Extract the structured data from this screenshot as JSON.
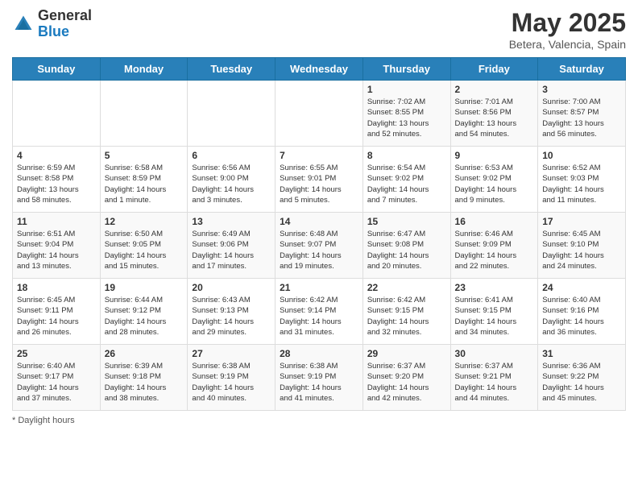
{
  "header": {
    "logo_general": "General",
    "logo_blue": "Blue",
    "month": "May 2025",
    "location": "Betera, Valencia, Spain"
  },
  "days_of_week": [
    "Sunday",
    "Monday",
    "Tuesday",
    "Wednesday",
    "Thursday",
    "Friday",
    "Saturday"
  ],
  "weeks": [
    [
      {
        "day": "",
        "info": ""
      },
      {
        "day": "",
        "info": ""
      },
      {
        "day": "",
        "info": ""
      },
      {
        "day": "",
        "info": ""
      },
      {
        "day": "1",
        "info": "Sunrise: 7:02 AM\nSunset: 8:55 PM\nDaylight: 13 hours\nand 52 minutes."
      },
      {
        "day": "2",
        "info": "Sunrise: 7:01 AM\nSunset: 8:56 PM\nDaylight: 13 hours\nand 54 minutes."
      },
      {
        "day": "3",
        "info": "Sunrise: 7:00 AM\nSunset: 8:57 PM\nDaylight: 13 hours\nand 56 minutes."
      }
    ],
    [
      {
        "day": "4",
        "info": "Sunrise: 6:59 AM\nSunset: 8:58 PM\nDaylight: 13 hours\nand 58 minutes."
      },
      {
        "day": "5",
        "info": "Sunrise: 6:58 AM\nSunset: 8:59 PM\nDaylight: 14 hours\nand 1 minute."
      },
      {
        "day": "6",
        "info": "Sunrise: 6:56 AM\nSunset: 9:00 PM\nDaylight: 14 hours\nand 3 minutes."
      },
      {
        "day": "7",
        "info": "Sunrise: 6:55 AM\nSunset: 9:01 PM\nDaylight: 14 hours\nand 5 minutes."
      },
      {
        "day": "8",
        "info": "Sunrise: 6:54 AM\nSunset: 9:02 PM\nDaylight: 14 hours\nand 7 minutes."
      },
      {
        "day": "9",
        "info": "Sunrise: 6:53 AM\nSunset: 9:02 PM\nDaylight: 14 hours\nand 9 minutes."
      },
      {
        "day": "10",
        "info": "Sunrise: 6:52 AM\nSunset: 9:03 PM\nDaylight: 14 hours\nand 11 minutes."
      }
    ],
    [
      {
        "day": "11",
        "info": "Sunrise: 6:51 AM\nSunset: 9:04 PM\nDaylight: 14 hours\nand 13 minutes."
      },
      {
        "day": "12",
        "info": "Sunrise: 6:50 AM\nSunset: 9:05 PM\nDaylight: 14 hours\nand 15 minutes."
      },
      {
        "day": "13",
        "info": "Sunrise: 6:49 AM\nSunset: 9:06 PM\nDaylight: 14 hours\nand 17 minutes."
      },
      {
        "day": "14",
        "info": "Sunrise: 6:48 AM\nSunset: 9:07 PM\nDaylight: 14 hours\nand 19 minutes."
      },
      {
        "day": "15",
        "info": "Sunrise: 6:47 AM\nSunset: 9:08 PM\nDaylight: 14 hours\nand 20 minutes."
      },
      {
        "day": "16",
        "info": "Sunrise: 6:46 AM\nSunset: 9:09 PM\nDaylight: 14 hours\nand 22 minutes."
      },
      {
        "day": "17",
        "info": "Sunrise: 6:45 AM\nSunset: 9:10 PM\nDaylight: 14 hours\nand 24 minutes."
      }
    ],
    [
      {
        "day": "18",
        "info": "Sunrise: 6:45 AM\nSunset: 9:11 PM\nDaylight: 14 hours\nand 26 minutes."
      },
      {
        "day": "19",
        "info": "Sunrise: 6:44 AM\nSunset: 9:12 PM\nDaylight: 14 hours\nand 28 minutes."
      },
      {
        "day": "20",
        "info": "Sunrise: 6:43 AM\nSunset: 9:13 PM\nDaylight: 14 hours\nand 29 minutes."
      },
      {
        "day": "21",
        "info": "Sunrise: 6:42 AM\nSunset: 9:14 PM\nDaylight: 14 hours\nand 31 minutes."
      },
      {
        "day": "22",
        "info": "Sunrise: 6:42 AM\nSunset: 9:15 PM\nDaylight: 14 hours\nand 32 minutes."
      },
      {
        "day": "23",
        "info": "Sunrise: 6:41 AM\nSunset: 9:15 PM\nDaylight: 14 hours\nand 34 minutes."
      },
      {
        "day": "24",
        "info": "Sunrise: 6:40 AM\nSunset: 9:16 PM\nDaylight: 14 hours\nand 36 minutes."
      }
    ],
    [
      {
        "day": "25",
        "info": "Sunrise: 6:40 AM\nSunset: 9:17 PM\nDaylight: 14 hours\nand 37 minutes."
      },
      {
        "day": "26",
        "info": "Sunrise: 6:39 AM\nSunset: 9:18 PM\nDaylight: 14 hours\nand 38 minutes."
      },
      {
        "day": "27",
        "info": "Sunrise: 6:38 AM\nSunset: 9:19 PM\nDaylight: 14 hours\nand 40 minutes."
      },
      {
        "day": "28",
        "info": "Sunrise: 6:38 AM\nSunset: 9:19 PM\nDaylight: 14 hours\nand 41 minutes."
      },
      {
        "day": "29",
        "info": "Sunrise: 6:37 AM\nSunset: 9:20 PM\nDaylight: 14 hours\nand 42 minutes."
      },
      {
        "day": "30",
        "info": "Sunrise: 6:37 AM\nSunset: 9:21 PM\nDaylight: 14 hours\nand 44 minutes."
      },
      {
        "day": "31",
        "info": "Sunrise: 6:36 AM\nSunset: 9:22 PM\nDaylight: 14 hours\nand 45 minutes."
      }
    ]
  ],
  "footer": {
    "note": "Daylight hours"
  }
}
